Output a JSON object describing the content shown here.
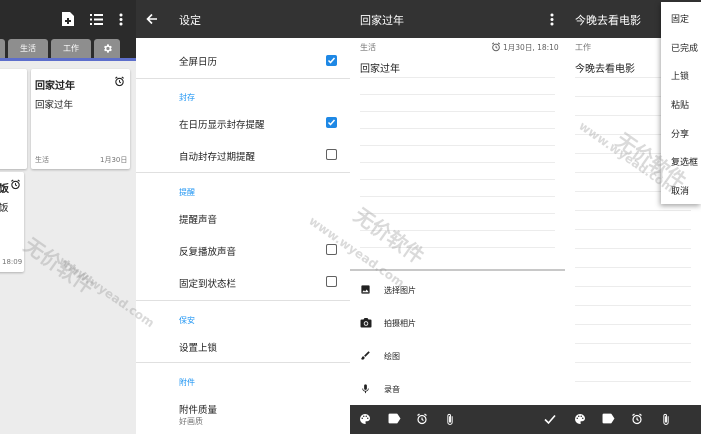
{
  "list_panel": {
    "tabs": [
      "生活",
      "工作"
    ],
    "card1": {
      "title": "回家过年",
      "body": "回家过年",
      "category": "生活",
      "date": "1月30日"
    },
    "card2": {
      "title_fragment": "饭",
      "body_fragment": "饭",
      "time": "18:09"
    }
  },
  "settings": {
    "title": "设定",
    "items": [
      {
        "label": "全屏日历",
        "checked": true
      },
      {
        "section": "封存"
      },
      {
        "label": "在日历显示封存提醒",
        "checked": true
      },
      {
        "label": "自动封存过期提醒",
        "checked": false
      },
      {
        "section": "提醒"
      },
      {
        "label": "提醒声音"
      },
      {
        "label": "反复播放声音",
        "checked": false
      },
      {
        "label": "固定到状态栏",
        "checked": false
      },
      {
        "section": "保安"
      },
      {
        "label": "设置上锁"
      },
      {
        "section": "附件"
      },
      {
        "label": "附件质量",
        "sub": "好画质"
      }
    ]
  },
  "editor": {
    "title": "回家过年",
    "category": "生活",
    "date": "1月30日, 18:10",
    "body": "回家过年",
    "attach_options": [
      "选择图片",
      "拍摄相片",
      "绘图",
      "录音"
    ]
  },
  "note_menu": {
    "title": "今晚去看电影",
    "category": "工作",
    "body": "今晚去看电影",
    "menu_items": [
      "固定",
      "已完成",
      "上锁",
      "粘贴",
      "分享",
      "复选框",
      "取消"
    ]
  },
  "watermark": {
    "text": "无价软件",
    "url": "www.wyead.com"
  },
  "colors": {
    "accent": "#1e88e5",
    "toolbar": "#333333",
    "tab_indicator": "#5d6ecb",
    "section": "#2196f3"
  }
}
